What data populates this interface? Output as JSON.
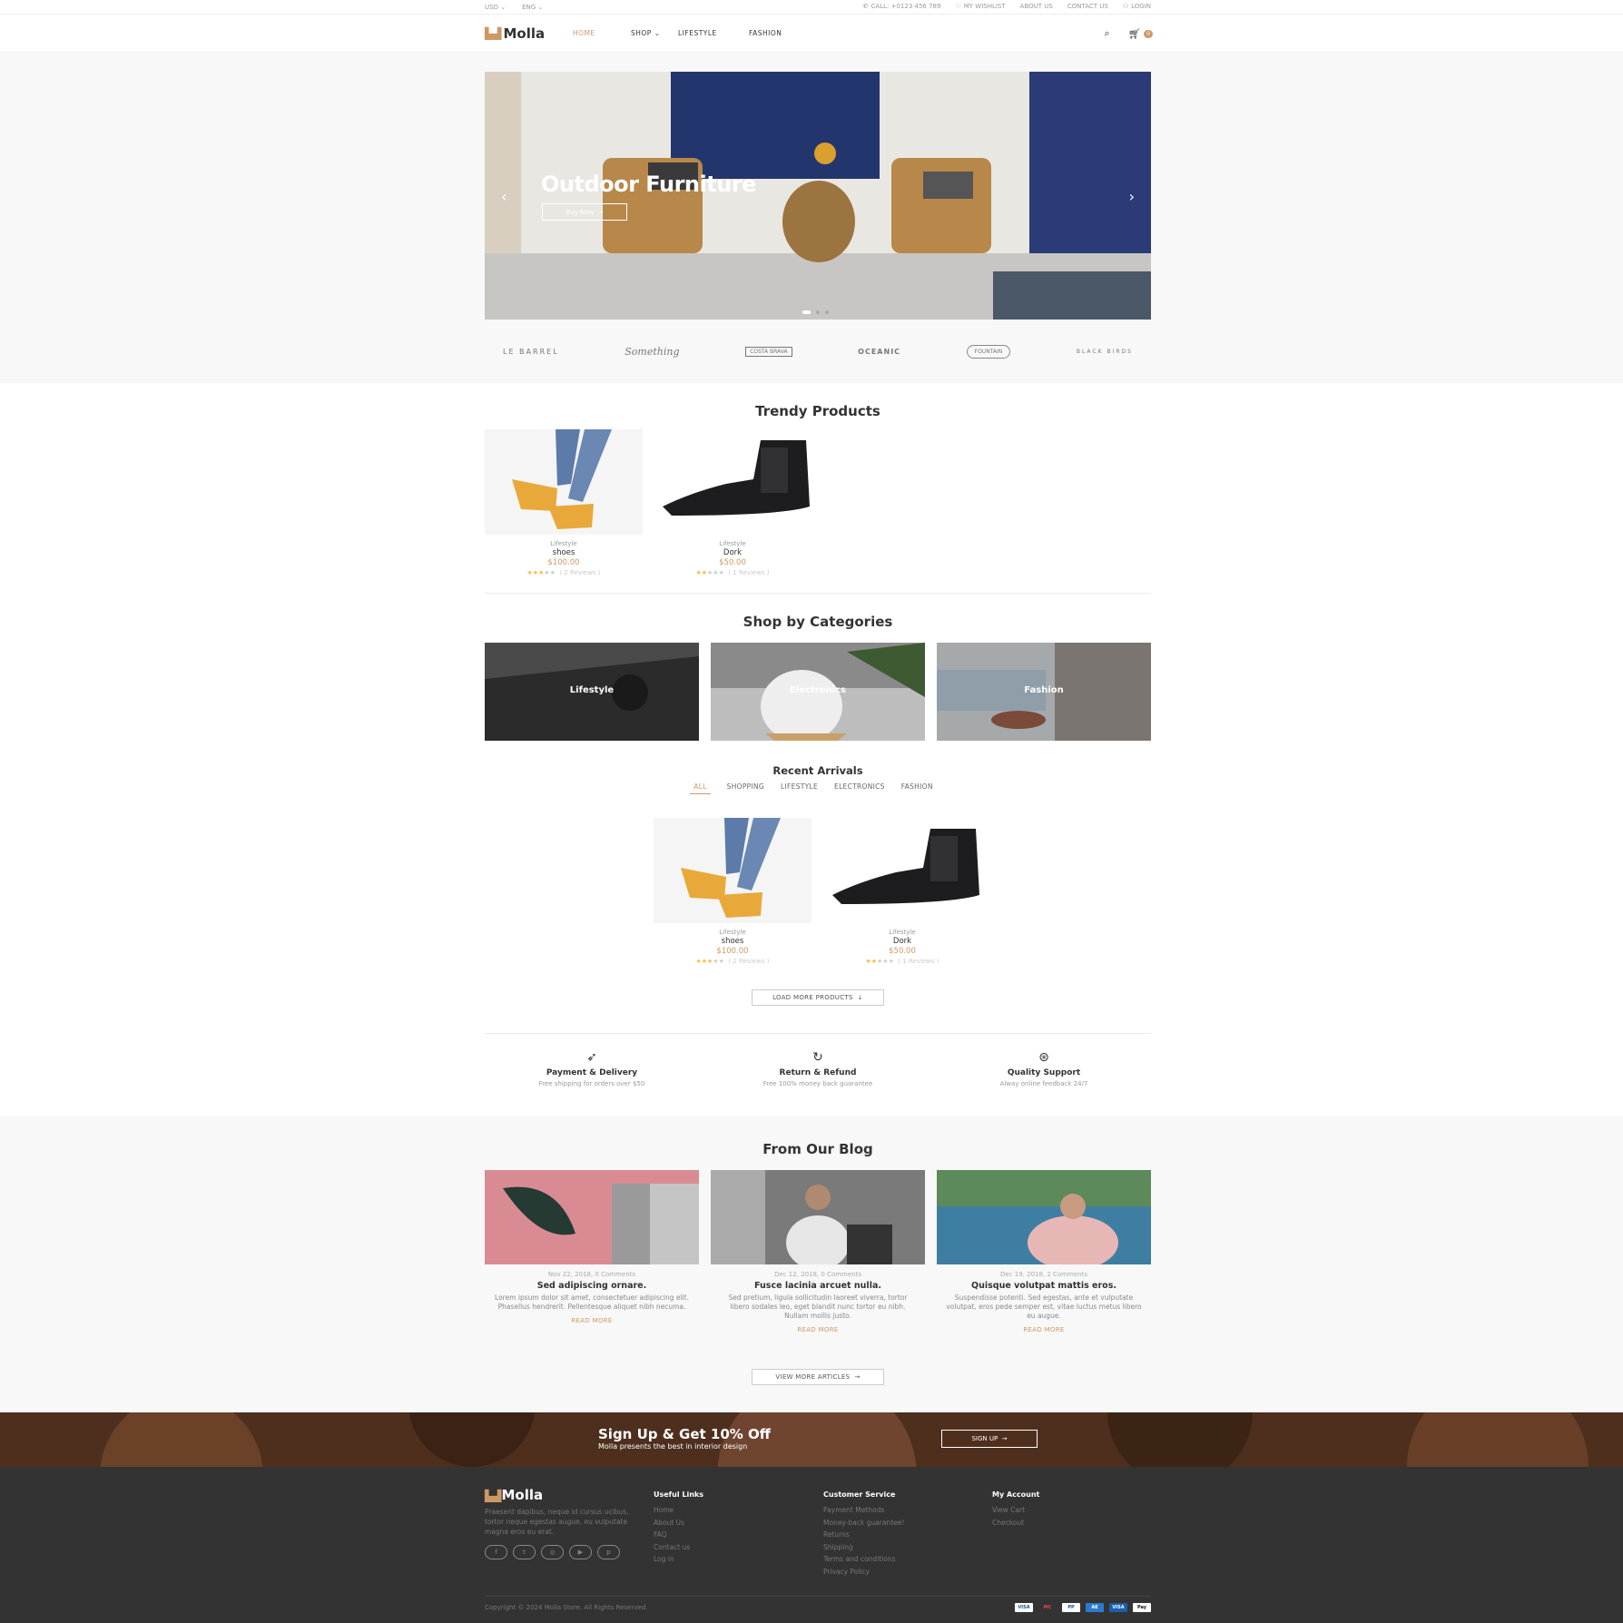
{
  "topbar": {
    "currency": "USD",
    "language": "ENG",
    "call": "CALL: +0123 456 789",
    "wishlist": "MY WISHLIST",
    "about": "ABOUT US",
    "contact": "CONTACT US",
    "login": "LOGIN"
  },
  "header": {
    "logo": "Molla",
    "nav": [
      "HOME",
      "SHOP",
      "LIFESTYLE",
      "FASHION"
    ],
    "cart_count": "0"
  },
  "hero": {
    "title": "Outdoor Furniture",
    "button": "Buy Now"
  },
  "brands": [
    "LE BARREL",
    "Something",
    "COSTA BRAVA",
    "OCEANIC",
    "FOUNTAIN",
    "BLACK BIRDS"
  ],
  "trendy": {
    "title": "Trendy Products",
    "products": [
      {
        "category": "Lifestyle",
        "name": "shoes",
        "price": "$100.00",
        "reviews": "( 2 Reviews )",
        "rating": 3
      },
      {
        "category": "Lifestyle",
        "name": "Dork",
        "price": "$50.00",
        "reviews": "( 1 Reviews )",
        "rating": 2
      }
    ]
  },
  "categories": {
    "title": "Shop by Categories",
    "items": [
      "Lifestyle",
      "Electronics",
      "Fashion"
    ]
  },
  "recent": {
    "title": "Recent Arrivals",
    "filters": [
      "ALL",
      "SHOPPING",
      "LIFESTYLE",
      "ELECTRONICS",
      "FASHION"
    ],
    "products": [
      {
        "category": "Lifestyle",
        "name": "shoes",
        "price": "$100.00",
        "reviews": "( 2 Reviews )",
        "rating": 3
      },
      {
        "category": "Lifestyle",
        "name": "Dork",
        "price": "$50.00",
        "reviews": "( 1 Reviews )",
        "rating": 2
      }
    ],
    "load_more": "LOAD MORE PRODUCTS"
  },
  "features": [
    {
      "title": "Payment & Delivery",
      "desc": "Free shipping for orders over $50"
    },
    {
      "title": "Return & Refund",
      "desc": "Free 100% money back guarantee"
    },
    {
      "title": "Quality Support",
      "desc": "Alway online feedback 24/7"
    }
  ],
  "blog": {
    "title": "From Our Blog",
    "posts": [
      {
        "meta": "Nov 22, 2018, 0 Comments",
        "title": "Sed adipiscing ornare.",
        "excerpt": "Lorem ipsum dolor sit amet, consectetuer adipiscing elit. Phasellus hendrerit. Pellentesque aliquet nibh necuma.",
        "more": "READ MORE"
      },
      {
        "meta": "Dec 12, 2018, 0 Comments",
        "title": "Fusce lacinia arcuet nulla.",
        "excerpt": "Sed pretium, ligula sollicitudin laoreet viverra, tortor libero sodales leo, eget blandit nunc tortor eu nibh. Nullam mollis justo.",
        "more": "READ MORE"
      },
      {
        "meta": "Dec 19, 2018, 2 Comments",
        "title": "Quisque volutpat mattis eros.",
        "excerpt": "Suspendisse potenti. Sed egestas, ante et vulputate volutpat, eros pede semper est, vitae luctus metus libero eu augue.",
        "more": "READ MORE"
      }
    ],
    "view_more": "VIEW MORE ARTICLES"
  },
  "cta": {
    "title": "Sign Up & Get 10% Off",
    "subtitle": "Molla presents the best in interior design",
    "button": "SIGN UP"
  },
  "footer": {
    "logo": "Molla",
    "about": "Praesent dapibus, neque id cursus ucibus, tortor neque egestas augue, eu vulputate magna eros eu erat.",
    "columns": [
      {
        "title": "Useful Links",
        "links": [
          "Home",
          "About Us",
          "FAQ",
          "Contact us",
          "Log in"
        ]
      },
      {
        "title": "Customer Service",
        "links": [
          "Payment Methods",
          "Money-back guarantee!",
          "Returns",
          "Shipping",
          "Terms and conditions",
          "Privacy Policy"
        ]
      },
      {
        "title": "My Account",
        "links": [
          "View Cart",
          "Checkout"
        ]
      }
    ],
    "copyright": "Copyright © 2024 Molla Store. All Rights Reserved.",
    "payments": [
      "VISA",
      "MC",
      "PP",
      "AE",
      "VISA",
      "Pay"
    ]
  },
  "colors": {
    "accent": "#cc9966",
    "footer_bg": "#333333",
    "section_bg": "#f8f8f8"
  }
}
